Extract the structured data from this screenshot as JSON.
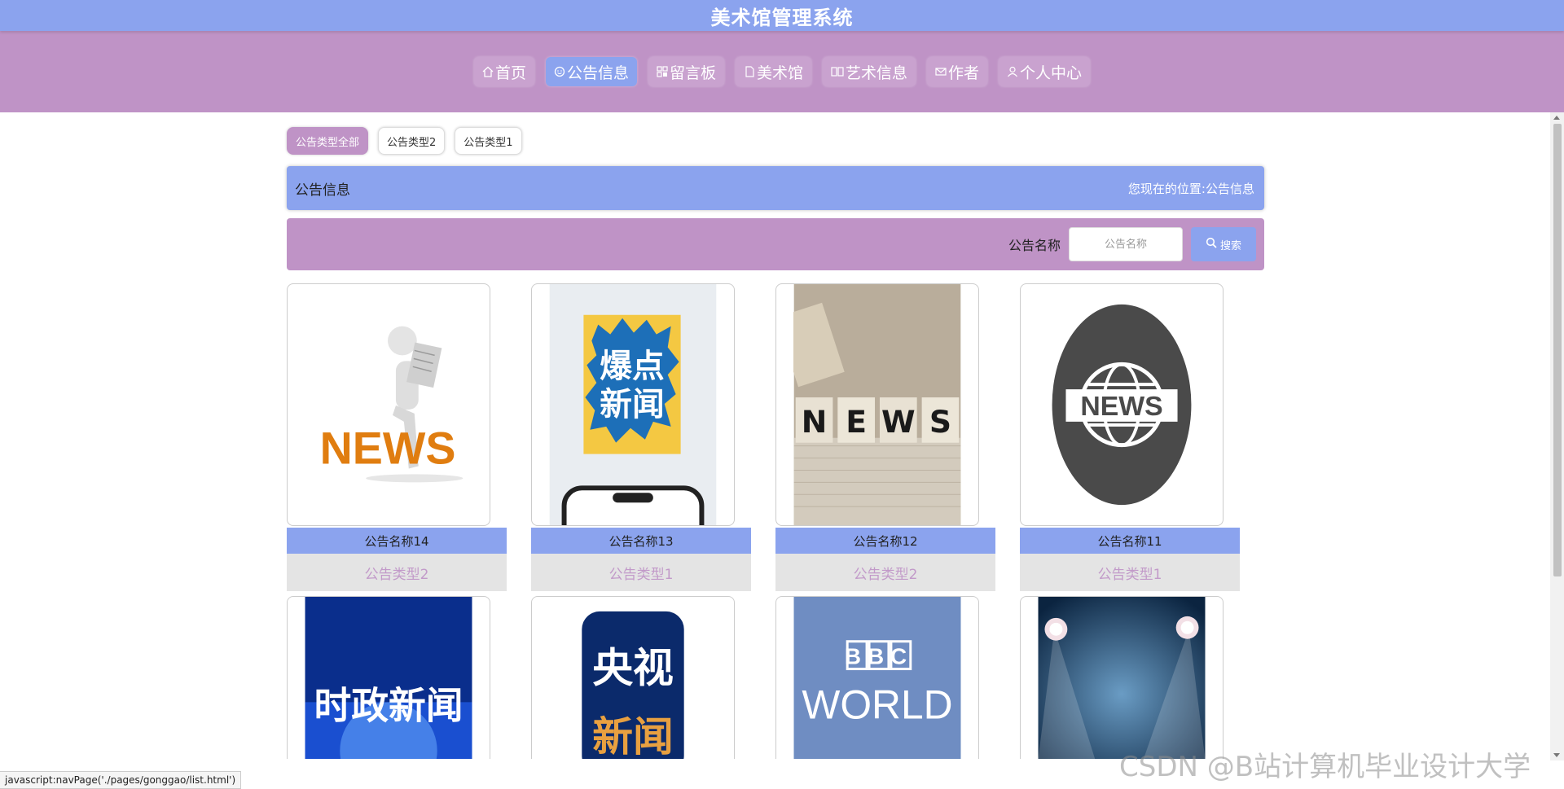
{
  "app": {
    "title": "美术馆管理系统"
  },
  "nav": {
    "items": [
      {
        "label": "首页",
        "icon": "home-icon",
        "active": false
      },
      {
        "label": "公告信息",
        "icon": "announcement-icon",
        "active": true
      },
      {
        "label": "留言板",
        "icon": "grid-icon",
        "active": false
      },
      {
        "label": "美术馆",
        "icon": "document-icon",
        "active": false
      },
      {
        "label": "艺术信息",
        "icon": "book-icon",
        "active": false
      },
      {
        "label": "作者",
        "icon": "mail-icon",
        "active": false
      },
      {
        "label": "个人中心",
        "icon": "user-icon",
        "active": false
      }
    ]
  },
  "types": {
    "items": [
      {
        "label": "公告类型全部",
        "active": true
      },
      {
        "label": "公告类型2",
        "active": false
      },
      {
        "label": "公告类型1",
        "active": false
      }
    ]
  },
  "breadcrumb": {
    "title": "公告信息",
    "location_label": "您现在的位置:",
    "location_value": "公告信息"
  },
  "search": {
    "label": "公告名称",
    "placeholder": "公告名称",
    "button_label": "搜索"
  },
  "cards": [
    {
      "name": "公告名称14",
      "type": "公告类型2",
      "art": "news-figure"
    },
    {
      "name": "公告名称13",
      "type": "公告类型1",
      "art": "phone-poster"
    },
    {
      "name": "公告名称12",
      "type": "公告类型2",
      "art": "news-blocks"
    },
    {
      "name": "公告名称11",
      "type": "公告类型1",
      "art": "globe-news"
    },
    {
      "name": "",
      "type": "",
      "art": "politics-news",
      "art_text": "时政新闻"
    },
    {
      "name": "",
      "type": "",
      "art": "cctv-news",
      "art_text_1": "央视",
      "art_text_2": "新闻"
    },
    {
      "name": "",
      "type": "",
      "art": "bbc-world",
      "art_text_1": "BBC",
      "art_text_2": "WORLD"
    },
    {
      "name": "",
      "type": "",
      "art": "spotlights"
    }
  ],
  "art_text": {
    "news": "NEWS",
    "poster_1": "爆点",
    "poster_2": "新闻"
  },
  "status_bar": {
    "url": "javascript:navPage('./pages/gonggao/list.html')"
  },
  "watermark": {
    "text": "CSDN @B站计算机毕业设计大学"
  },
  "colors": {
    "primary": "#8ba3ee",
    "secondary": "#bf93c6",
    "card_type_text": "#c29ac9"
  }
}
